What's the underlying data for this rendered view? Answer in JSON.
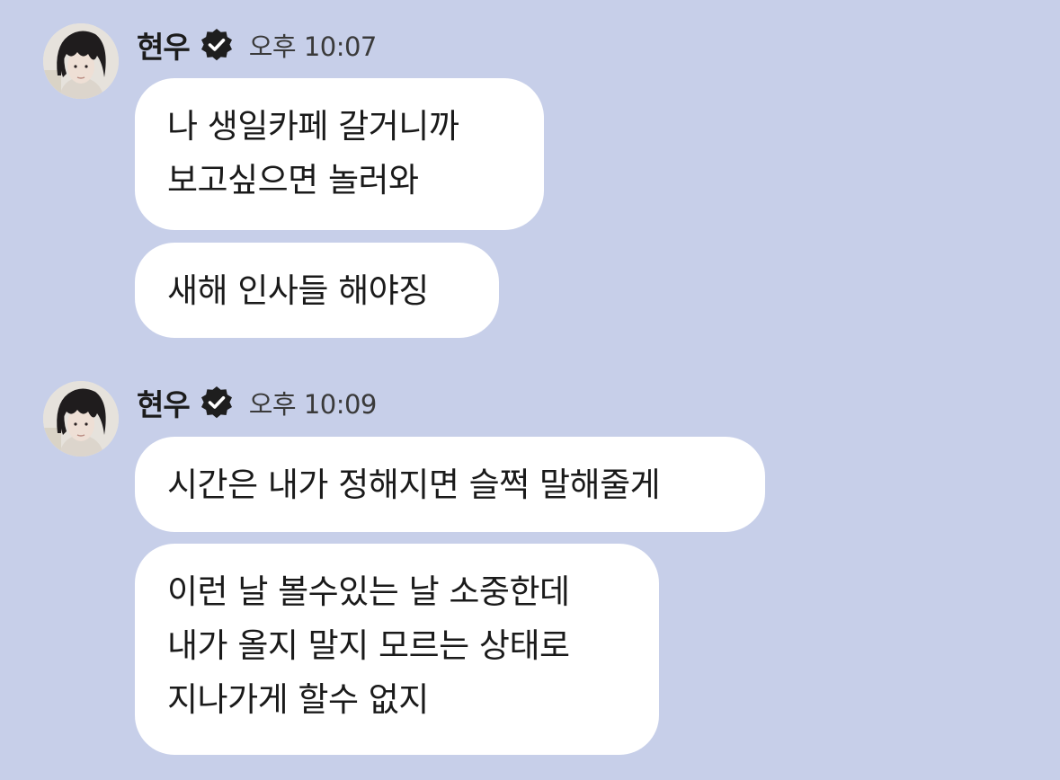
{
  "groups": [
    {
      "sender": "현우",
      "time": "오후 10:07",
      "messages": [
        {
          "lines": [
            "나 생일카페 갈거니까",
            "보고싶으면 놀러와"
          ]
        },
        {
          "lines": [
            "새해 인사들 해야징"
          ]
        }
      ]
    },
    {
      "sender": "현우",
      "time": "오후 10:09",
      "messages": [
        {
          "lines": [
            "시간은 내가 정해지면 슬쩍 말해줄게"
          ]
        },
        {
          "lines": [
            "이런 날 볼수있는 날 소중한데",
            "내가 올지 말지 모르는 상태로",
            "지나가게 할수 없지"
          ]
        }
      ]
    }
  ],
  "icons": {
    "avatar": "profile-photo",
    "verified": "verified-badge-icon"
  },
  "colors": {
    "background": "#c7cfe9",
    "bubble": "#ffffff",
    "text": "#1a1a1a",
    "badge": "#1e1e1e"
  }
}
